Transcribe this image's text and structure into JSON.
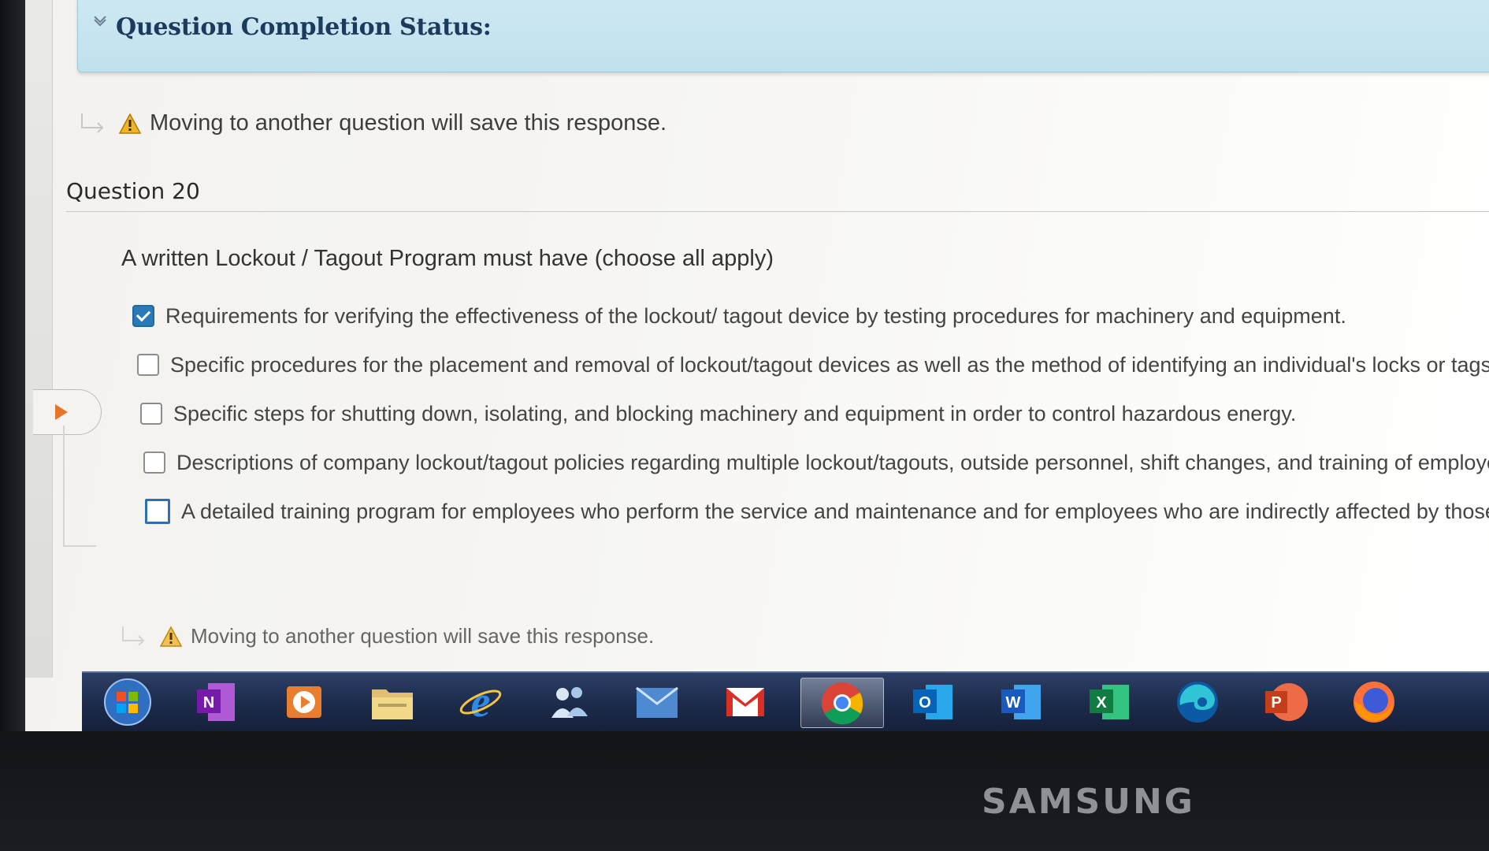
{
  "status_panel": {
    "title": "Question Completion Status:"
  },
  "warning_top": "Moving to another question will save this response.",
  "question": {
    "label": "Question 20",
    "prompt": "A written Lockout / Tagout Program must have (choose all apply)",
    "options": [
      {
        "text": "Requirements for verifying the effectiveness of the lockout/ tagout device by testing procedures for machinery and equipment.",
        "checked": true
      },
      {
        "text": "Specific procedures for the placement and removal of lockout/tagout devices as well as the method of identifying an individual's locks or tags.",
        "checked": false
      },
      {
        "text": "Specific steps for shutting down, isolating, and blocking machinery and equipment in order to control hazardous energy.",
        "checked": false
      },
      {
        "text": "Descriptions of company lockout/tagout policies regarding multiple lockout/tagouts, outside personnel, shift changes, and training of employees.",
        "checked": false
      },
      {
        "text": "A detailed training program for employees who perform the service and maintenance and for employees who are indirectly affected by those operation",
        "checked": false
      }
    ]
  },
  "warning_bottom": "Moving to another question will save this response.",
  "taskbar": {
    "apps": [
      "start",
      "onenote",
      "media-player",
      "file-explorer",
      "internet-explorer",
      "people",
      "mail-app",
      "gmail",
      "chrome",
      "outlook",
      "word",
      "excel",
      "edge",
      "powerpoint",
      "firefox"
    ],
    "letters": {
      "onenote": "N",
      "outlook": "O",
      "word": "W",
      "excel": "X",
      "powerpoint": "P"
    },
    "active": "chrome"
  },
  "monitor_brand": "SAMSUNG",
  "colors": {
    "accent": "#2a7ab8",
    "status_panel": "#c6e5f0",
    "taskbar": "#1d2c4c"
  }
}
